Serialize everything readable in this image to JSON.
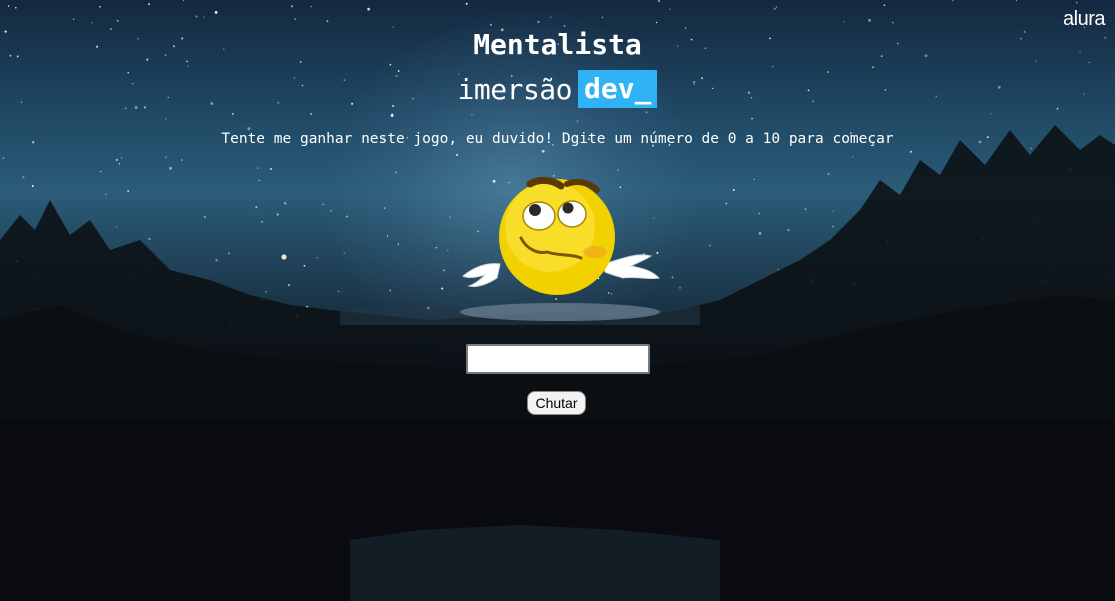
{
  "brand_logo": "alura",
  "header": {
    "title": "Mentalista",
    "brand_light": "imersão",
    "brand_box": "dev_"
  },
  "subtitle": "Tente me ganhar neste jogo, eu duvido! Dgite um número de 0 a 10 para começar",
  "guess": {
    "value": "",
    "button_label": "Chutar"
  },
  "icons": {
    "emoji": "thinking-emoji-shrug-icon",
    "logo": "alura-logo"
  },
  "colors": {
    "accent": "#2fb3f5",
    "text": "#ffffff"
  }
}
